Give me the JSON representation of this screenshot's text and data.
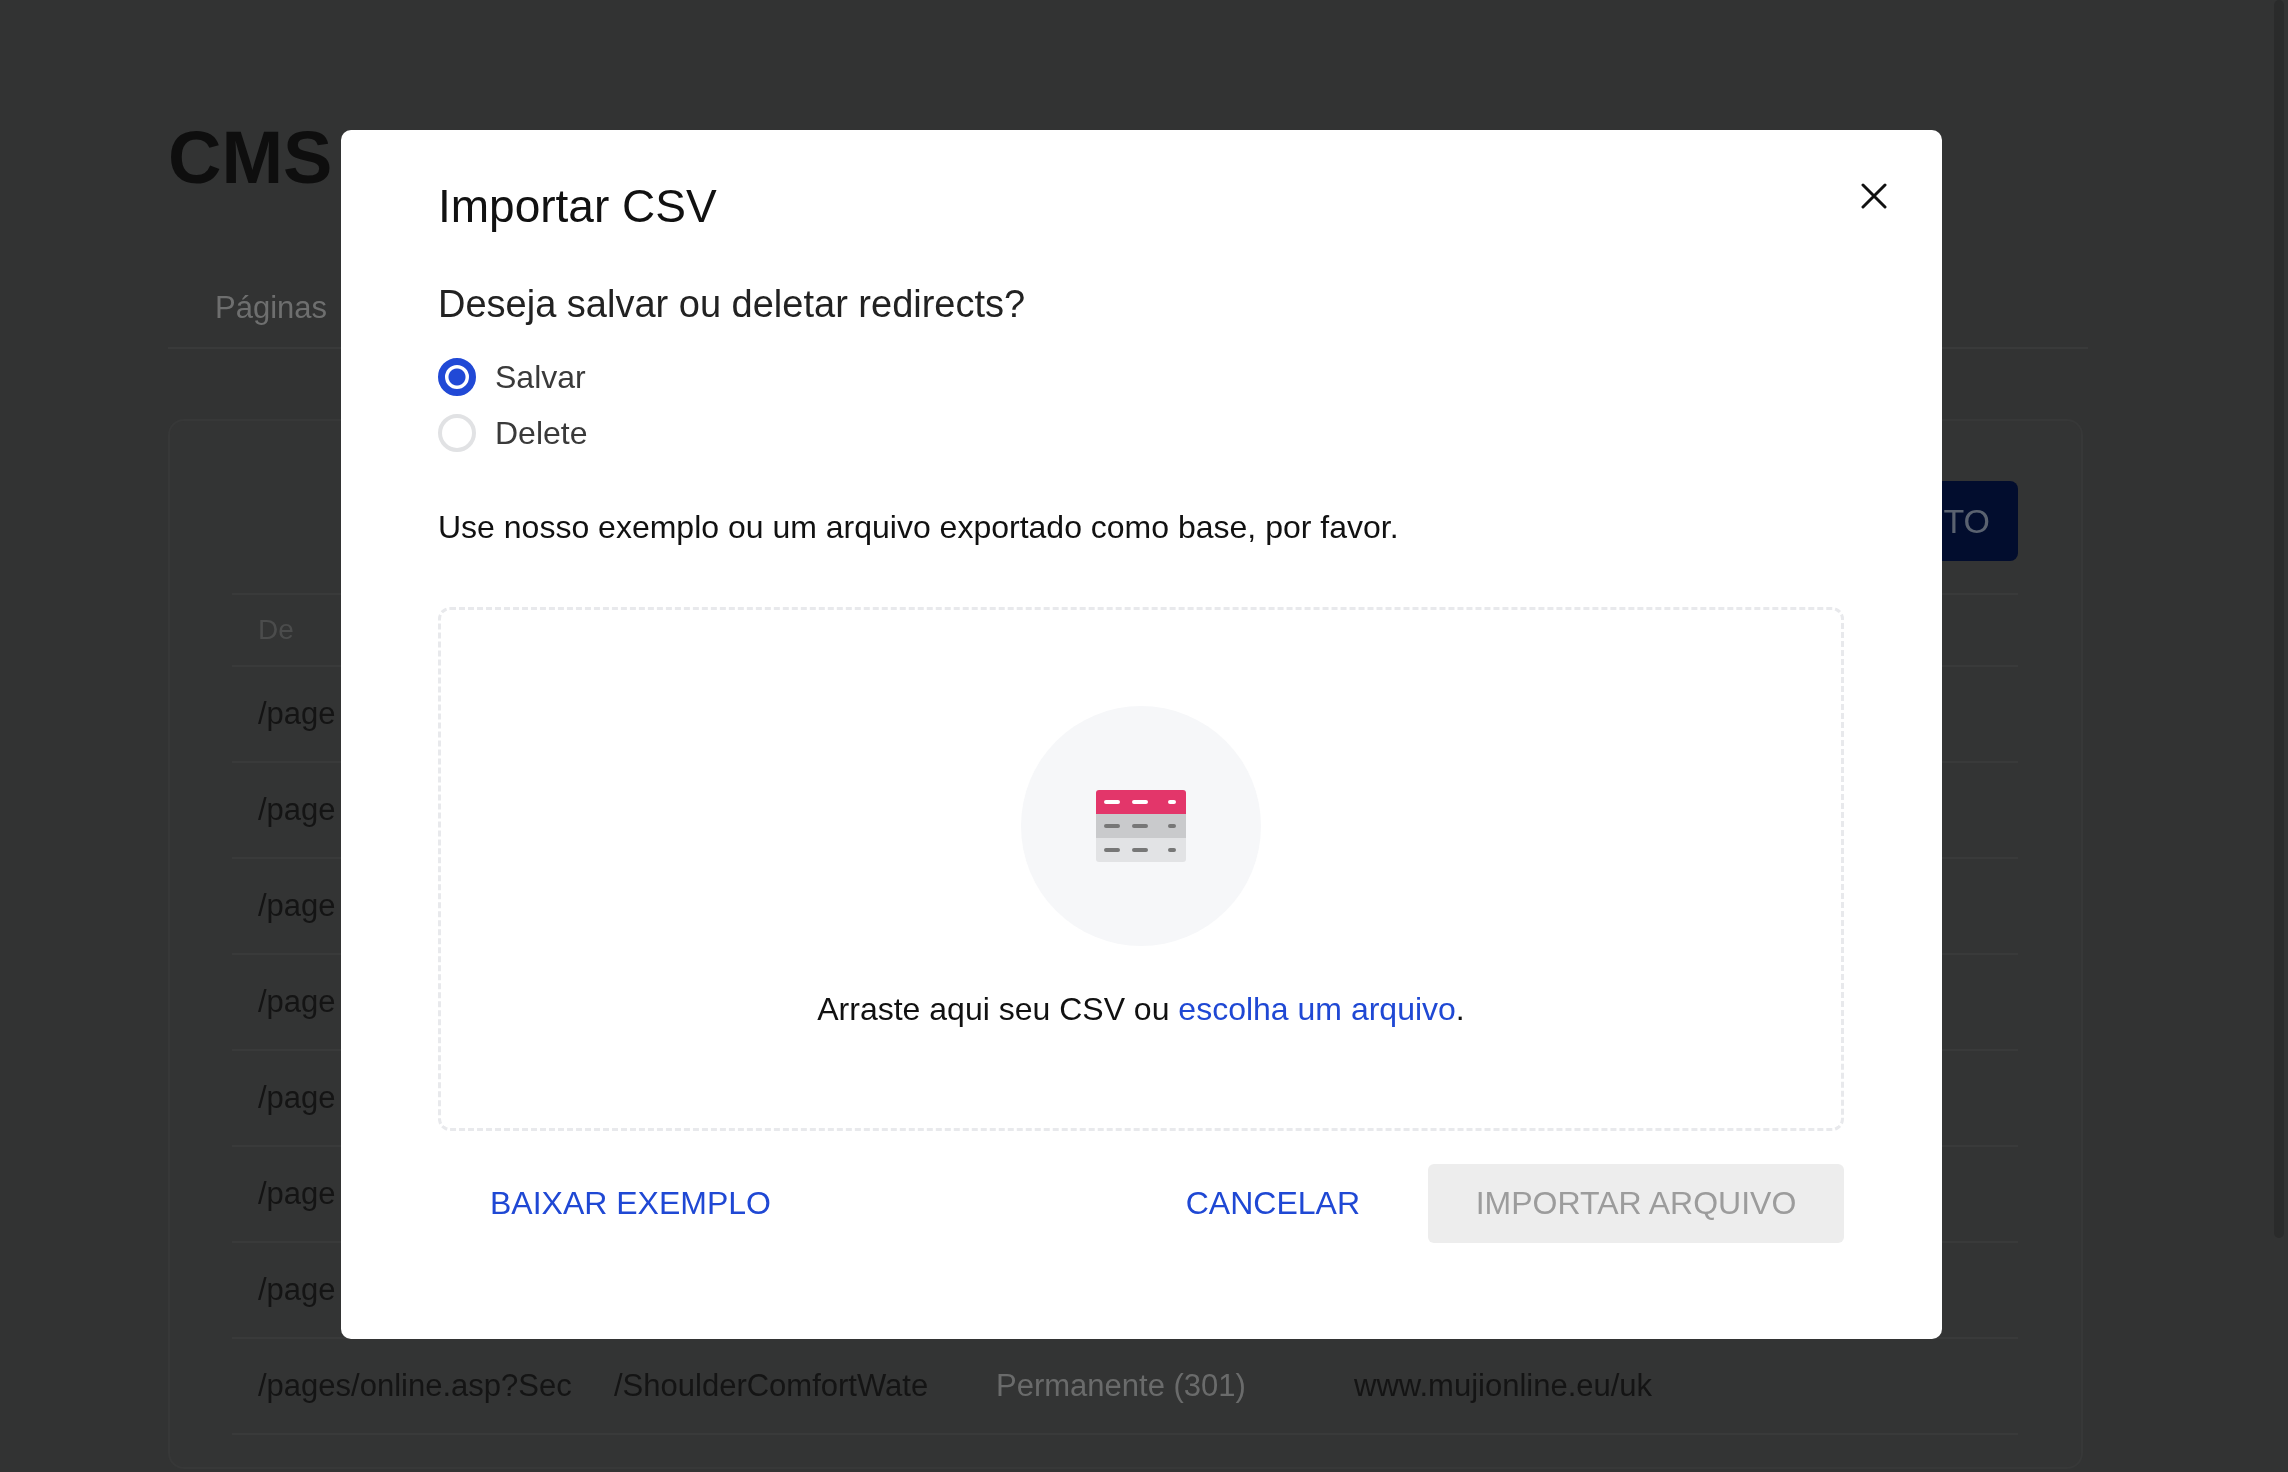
{
  "page": {
    "title": "CMS",
    "nav_tab": "Páginas",
    "action_button": "TO",
    "table": {
      "columns": [
        "De"
      ],
      "rows": [
        [
          "/page"
        ],
        [
          "/page"
        ],
        [
          "/page"
        ],
        [
          "/page"
        ],
        [
          "/page"
        ],
        [
          "/page"
        ],
        [
          "/page"
        ],
        [
          "/pages/online.asp?Sec",
          "/ShoulderComfortWate",
          "Permanente (301)",
          "www.mujionline.eu/uk"
        ]
      ]
    }
  },
  "dialog": {
    "title": "Importar CSV",
    "question": "Deseja salvar ou deletar redirects?",
    "options": [
      {
        "label": "Salvar",
        "selected": true
      },
      {
        "label": "Delete",
        "selected": false
      }
    ],
    "hint": "Use nosso exemplo ou um arquivo exportado como base, por favor.",
    "dropzone": {
      "text": "Arraste aqui seu CSV ou ",
      "link": "escolha um arquivo",
      "text_end": "."
    },
    "buttons": [
      {
        "label": "BAIXAR EXEMPLO",
        "kind": "text",
        "disabled": false
      },
      {
        "label": "CANCELAR",
        "kind": "text",
        "disabled": false
      },
      {
        "label": "IMPORTAR ARQUIVO",
        "kind": "filled",
        "disabled": true
      }
    ]
  }
}
